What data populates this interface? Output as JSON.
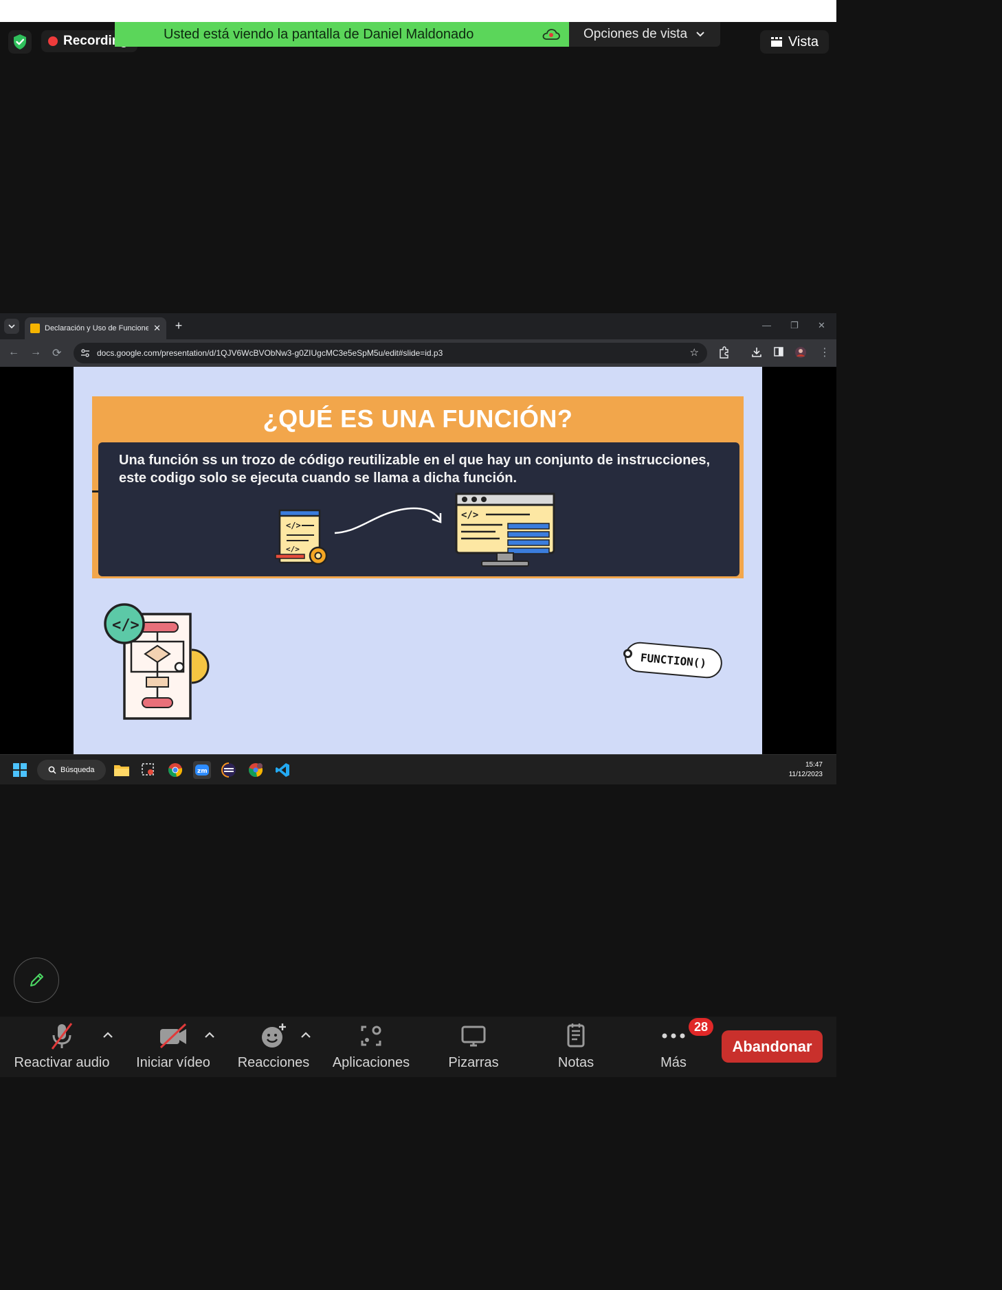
{
  "recording": {
    "label": "Recording"
  },
  "share_banner": {
    "text": "Usted está viendo la pantalla de Daniel Maldonado"
  },
  "view_options": {
    "label": "Opciones de vista"
  },
  "view_button": {
    "label": "Vista"
  },
  "browser": {
    "tab_title": "Declaración y Uso de Funciones",
    "url": "docs.google.com/presentation/d/1QJV6WcBVObNw3-g0ZIUgcMC3e5eSpM5u/edit#slide=id.p3"
  },
  "slide": {
    "title": "¿QUÉ ES UNA FUNCIÓN?",
    "body": "Una función ss un trozo de código reutilizable en el que hay un conjunto de instrucciones, este codigo solo se ejecuta cuando se llama a dicha función.",
    "tag": "FUNCTION()"
  },
  "taskbar": {
    "search_label": "Búsqueda",
    "time": "15:47",
    "date": "11/12/2023"
  },
  "toolbar": {
    "audio_label": "Reactivar audio",
    "video_label": "Iniciar vídeo",
    "reactions_label": "Reacciones",
    "apps_label": "Aplicaciones",
    "whiteboards_label": "Pizarras",
    "notes_label": "Notas",
    "more_label": "Más",
    "more_badge": "28",
    "leave_label": "Abandonar"
  },
  "colors": {
    "banner_green": "#5bd65a",
    "leave_red": "#c9302c",
    "slide_orange": "#f2a64b",
    "slide_bg": "#d1dbf8"
  }
}
